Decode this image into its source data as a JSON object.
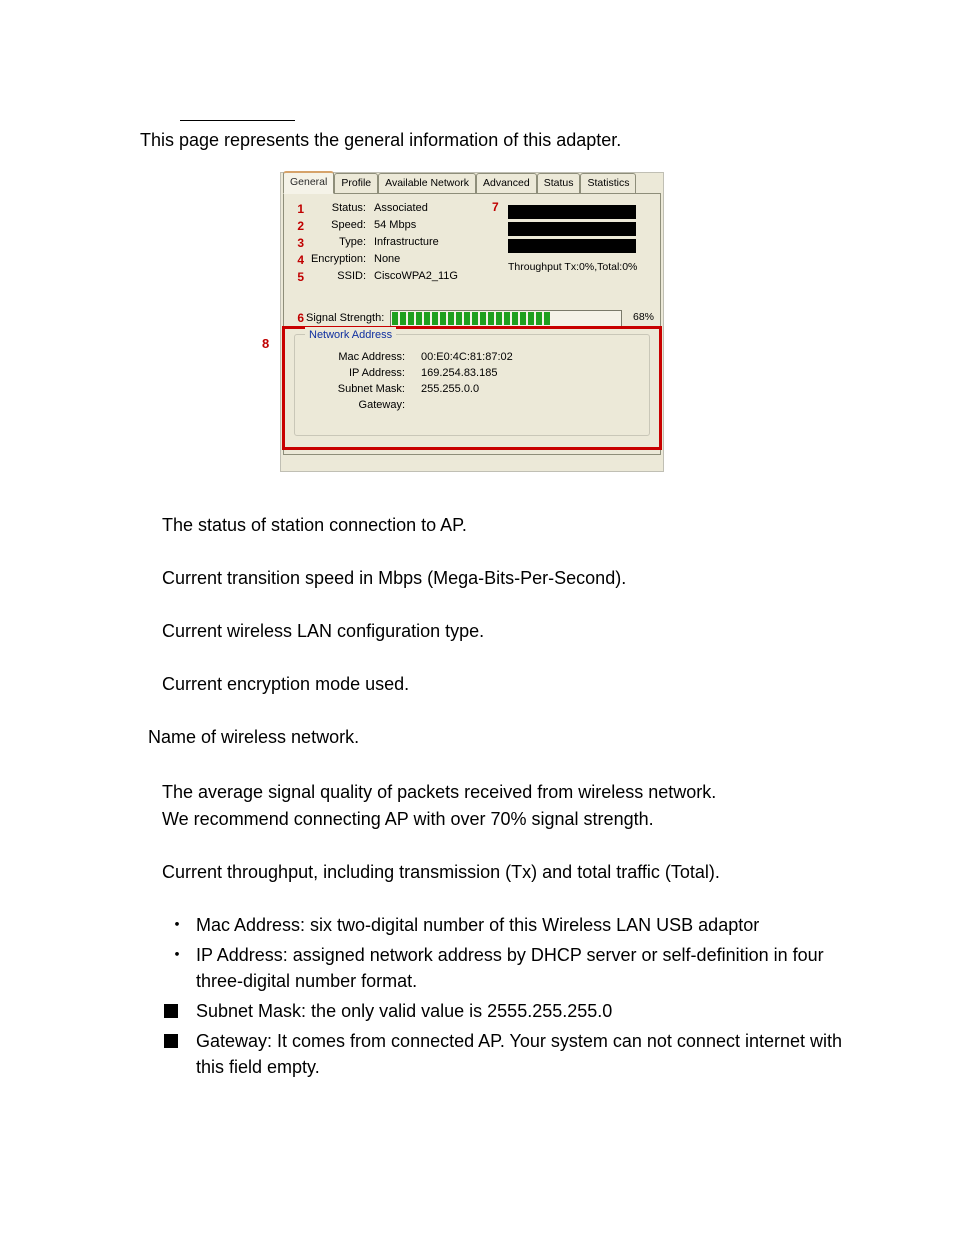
{
  "intro": "This page represents the general information of this adapter.",
  "tabs": {
    "t0": "General",
    "t1": "Profile",
    "t2": "Available Network",
    "t3": "Advanced",
    "t4": "Status",
    "t5": "Statistics"
  },
  "numbers": {
    "n1": "1",
    "n2": "2",
    "n3": "3",
    "n4": "4",
    "n5": "5",
    "n6": "6",
    "n7": "7",
    "n8": "8"
  },
  "labels": {
    "status": "Status:",
    "speed": "Speed:",
    "type": "Type:",
    "encryption": "Encryption:",
    "ssid": "SSID:",
    "signal": "Signal Strength:",
    "throughput": "Throughput Tx:0%,Total:0%",
    "netaddr": "Network Address",
    "mac": "Mac Address:",
    "ip": "IP Address:",
    "subnet": "Subnet Mask:",
    "gateway": "Gateway:"
  },
  "values": {
    "status": "Associated",
    "speed": "54 Mbps",
    "type": "Infrastructure",
    "encryption": "None",
    "ssid": "CiscoWPA2_11G",
    "signal_pct": "68%",
    "mac": "00:E0:4C:81:87:02",
    "ip": "169.254.83.185",
    "subnet": "255.255.0.0",
    "gateway": ""
  },
  "desc": {
    "d1": "The status of station connection to AP.",
    "d2": "Current transition speed in Mbps  (Mega-Bits-Per-Second).",
    "d3": "Current wireless LAN configuration type.",
    "d4": "Current encryption mode used.",
    "d5": "Name of wireless network.",
    "d6a": "The average signal quality of packets received from wireless network.",
    "d6b": "We recommend connecting AP with over 70% signal strength.",
    "d7": "Current throughput, including transmission (Tx) and total traffic (Total).",
    "b1": "Mac Address: six two-digital number of this Wireless LAN USB adaptor",
    "b2": "IP Address: assigned network address by DHCP server or self-definition in four three-digital number format.",
    "b3": "Subnet Mask: the only valid value is 2555.255.255.0",
    "b4": "Gateway: It comes from connected AP. Your system can not connect internet with this field empty."
  },
  "chart_data": {
    "type": "bar",
    "title": "Signal Strength",
    "value_percent": 68,
    "throughput": {
      "tx_percent": 0,
      "total_percent": 0
    }
  }
}
